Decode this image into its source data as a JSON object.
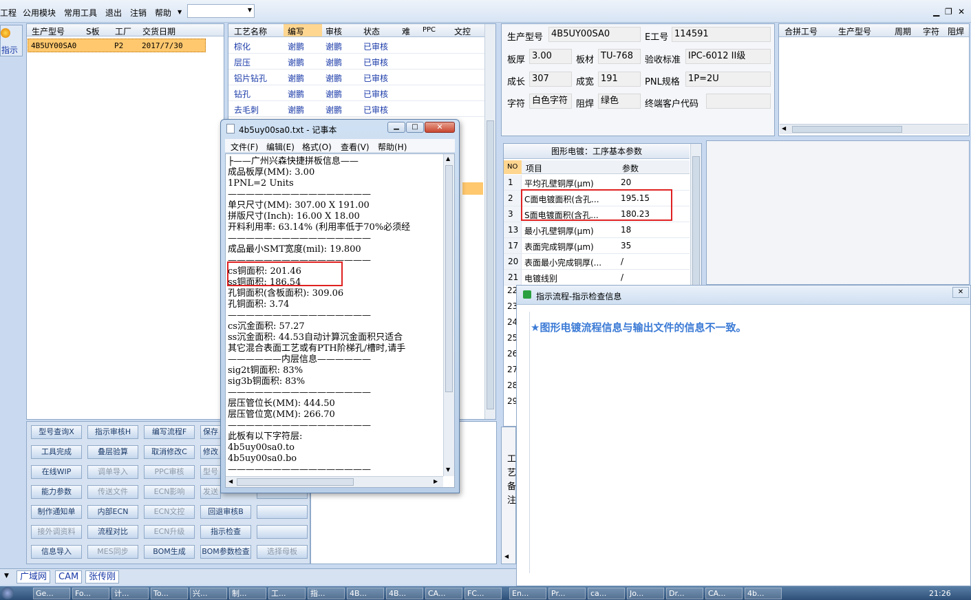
{
  "menu": {
    "items": [
      "工程",
      "公用模块",
      "常用工具",
      "退出",
      "注销",
      "帮助"
    ]
  },
  "left_tab": "指示",
  "orders": {
    "columns": [
      "生产型号",
      "S板",
      "工厂",
      "交货日期"
    ],
    "rows": [
      [
        "4B5UY00SA0",
        "",
        "P2",
        "2017/7/30"
      ]
    ]
  },
  "process": {
    "columns": [
      "工艺名称",
      "编写",
      "审核",
      "状态",
      "难",
      "PPC",
      "文控"
    ],
    "rows": [
      [
        "棕化",
        "谢鹏",
        "谢鹏",
        "已审核"
      ],
      [
        "层压",
        "谢鹏",
        "谢鹏",
        "已审核"
      ],
      [
        "铝片钻孔",
        "谢鹏",
        "谢鹏",
        "已审核"
      ],
      [
        "钻孔",
        "谢鹏",
        "谢鹏",
        "已审核"
      ],
      [
        "去毛刺",
        "谢鹏",
        "谢鹏",
        "已审核"
      ]
    ]
  },
  "info": {
    "prod_label": "生产型号",
    "prod_value": "4B5UY00SA0",
    "eno_label": "E工号",
    "eno_value": "114591",
    "thick_label": "板厚",
    "thick_value": "3.00",
    "mat_label": "板材",
    "mat_value": "TU-768",
    "std_label": "验收标准",
    "std_value": "IPC-6012 II级",
    "len_label": "成长",
    "len_value": "307",
    "wid_label": "成宽",
    "wid_value": "191",
    "pnl_label": "PNL规格",
    "pnl_value": "1P=2U",
    "char_label": "字符",
    "char_value": "白色字符",
    "mask_label": "阻焊",
    "mask_value": "绿色",
    "cust_label": "终端客户代码",
    "cust_value": ""
  },
  "merge": {
    "columns": [
      "合拼工号",
      "生产型号",
      "周期",
      "字符",
      "阻焊"
    ]
  },
  "params": {
    "title": "图形电镀：工序基本参数",
    "columns": [
      "NO",
      "项目",
      "参数"
    ],
    "rows": [
      [
        "1",
        "平均孔壁铜厚(μm)",
        "20"
      ],
      [
        "2",
        "C面电镀面积(含孔...",
        "195.15"
      ],
      [
        "3",
        "S面电镀面积(含孔...",
        "180.23"
      ],
      [
        "13",
        "最小孔壁铜厚(μm)",
        "18"
      ],
      [
        "17",
        "表面完成铜厚(μm)",
        "35"
      ],
      [
        "20",
        "表面最小完成铜厚(...",
        "/"
      ],
      [
        "21",
        "电镀线别",
        "/"
      ]
    ],
    "more_nos": [
      "22",
      "23",
      "24",
      "25",
      "26",
      "27",
      "28",
      "29"
    ]
  },
  "buttons": [
    [
      "型号查询X",
      "指示审核H",
      "编写流程F",
      "保存"
    ],
    [
      "工具完成",
      "叠层验算",
      "取消修改C",
      "修改"
    ],
    [
      "在线WIP",
      "调单导入",
      "PPC审核",
      "型号"
    ],
    [
      "能力参数",
      "传送文件",
      "ECN影响",
      "发送"
    ],
    [
      "制作通知单",
      "内部ECN",
      "ECN文控",
      "回退审核B"
    ],
    [
      "接外调资料",
      "流程对比",
      "ECN升级",
      "指示检查"
    ],
    [
      "信息导入",
      "MES同步",
      "BOM生成",
      "BOM参数检查",
      "选择母板"
    ]
  ],
  "side_labels": [
    "工",
    "艺",
    "备",
    "注"
  ],
  "status_tabs": [
    "广域网",
    "CAM",
    "张传刚"
  ],
  "notepad": {
    "title": "4b5uy00sa0.txt - 记事本",
    "menus": [
      "文件(F)",
      "编辑(E)",
      "格式(O)",
      "查看(V)",
      "帮助(H)"
    ],
    "lines": [
      "├——广州兴森快捷拼板信息——",
      "成品板厚(MM): 3.00",
      "1PNL=2 Units",
      "————————————————",
      "单只尺寸(MM): 307.00 X 191.00",
      "拼版尺寸(Inch): 16.00 X 18.00",
      "开料利用率: 63.14% (利用率低于70%必须经",
      "————————————————",
      "成品最小SMT宽度(mil): 19.800",
      "————————————————",
      "cs铜面积: 201.46",
      "ss铜面积: 186.54",
      "孔铜面积(含板面积): 309.06",
      "孔铜面积: 3.74",
      "————————————————",
      "cs沉金面积: 57.27",
      "ss沉金面积: 44.53自动计算沉金面积只适合",
      "其它混合表面工艺或有PTH阶梯孔/槽时,请手",
      "——————内层信息——————",
      "sig2t铜面积: 83%",
      "sig3b铜面积: 83%",
      "————————————————",
      "层压管位长(MM): 444.50",
      "层压管位宽(MM): 266.70",
      "————————————————",
      "此板有以下字符层:",
      "4b5uy00sa0.to",
      "4b5uy00sa0.bo",
      "————————————————"
    ]
  },
  "dialog": {
    "title": "指示流程-指示检查信息",
    "message": "★图形电镀流程信息与输出文件的信息不一致。"
  },
  "taskbar": {
    "items": [
      "Ge...",
      "Fo...",
      "计...",
      "To...",
      "兴...",
      "制...",
      "工...",
      "指...",
      "4B...",
      "4B...",
      "CA...",
      "FC...",
      "En...",
      "Pr...",
      "ca...",
      "Jo...",
      "Dr...",
      "CA...",
      "4b..."
    ],
    "clock": "21:26"
  },
  "colors": {
    "highlight": "#ffc86e",
    "link": "#1a3aa8",
    "redbox": "#e02020",
    "dialog_text": "#3c7bd6"
  }
}
